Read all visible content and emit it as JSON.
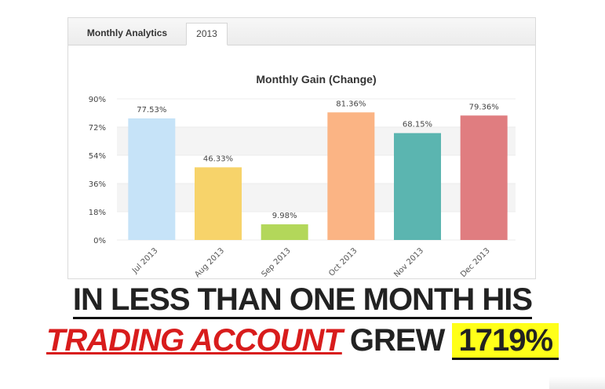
{
  "tabs": {
    "first": "Monthly Analytics",
    "active": "2013"
  },
  "chart_data": {
    "type": "bar",
    "title": "Monthly Gain (Change)",
    "categories": [
      "Jul 2013",
      "Aug 2013",
      "Sep 2013",
      "Oct 2013",
      "Nov 2013",
      "Dec 2013"
    ],
    "values": [
      77.53,
      46.33,
      9.98,
      81.36,
      68.15,
      79.36
    ],
    "value_labels": [
      "77.53%",
      "46.33%",
      "9.98%",
      "81.36%",
      "68.15%",
      "79.36%"
    ],
    "colors": [
      "#c6e3f8",
      "#f7d36a",
      "#b3d75a",
      "#fbb484",
      "#5bb5b0",
      "#e07d80"
    ],
    "yticks": [
      "90%",
      "72%",
      "54%",
      "36%",
      "18%",
      "0%"
    ],
    "ylim": [
      0,
      90
    ],
    "xlabel": "",
    "ylabel": "",
    "grid": "alternating bands",
    "legend": "none"
  },
  "headline": {
    "line1": "IN LESS THAN ONE MONTH HIS",
    "line2_red": "TRADING ACCOUNT",
    "line2_dark": "GREW",
    "line2_highlight": "1719%"
  }
}
